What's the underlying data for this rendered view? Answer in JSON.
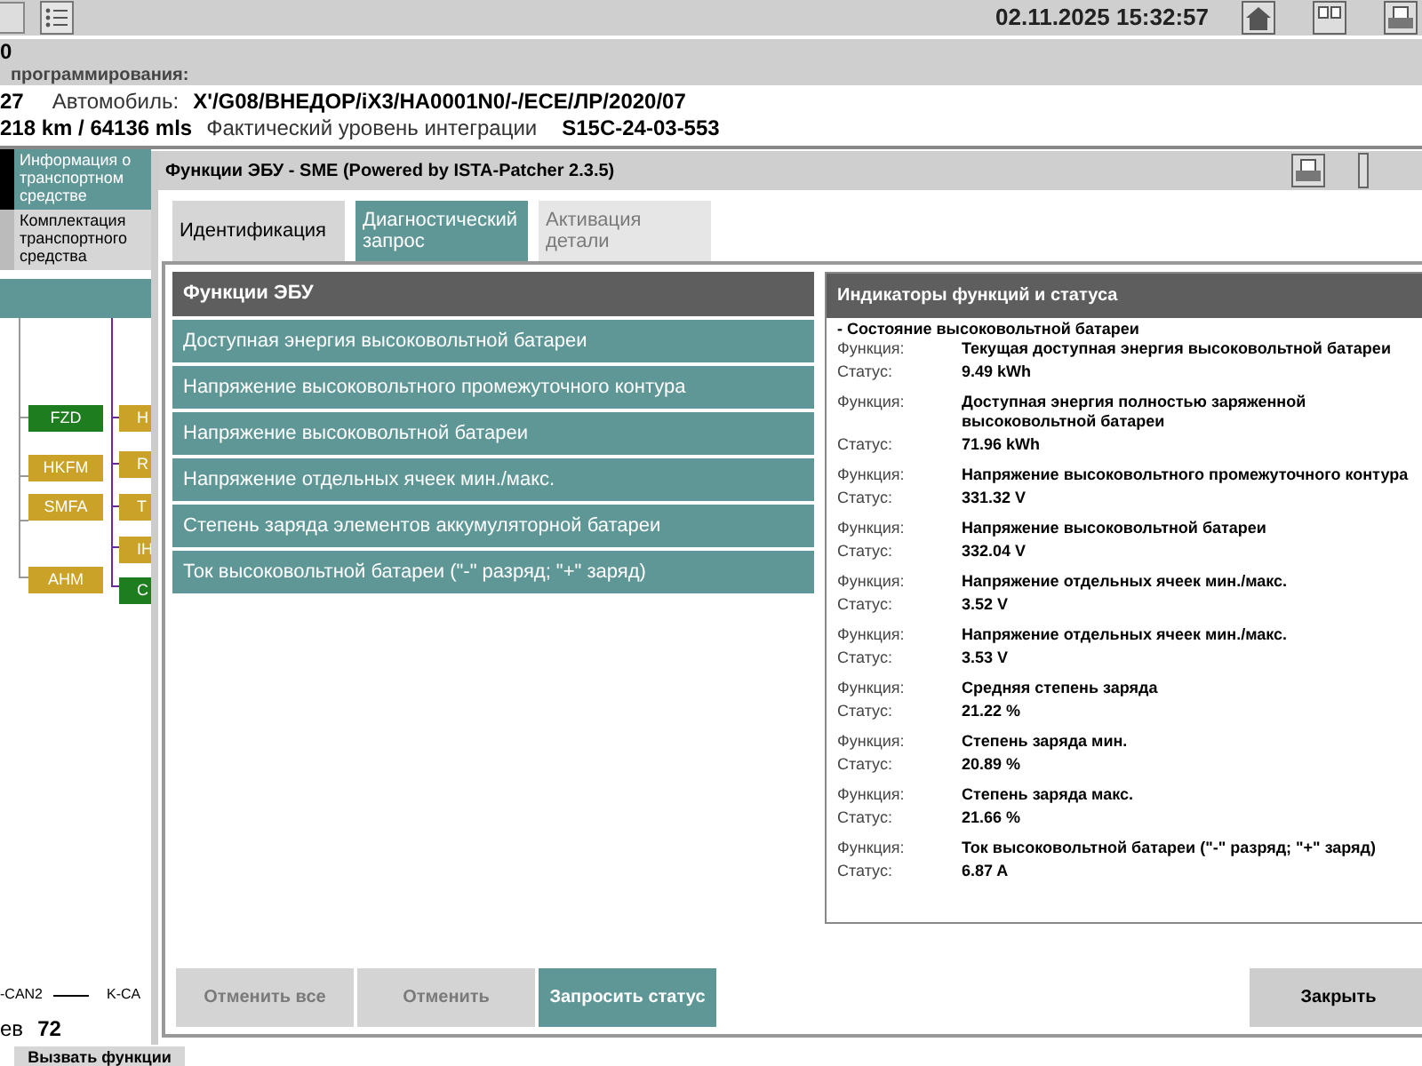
{
  "toolbar": {
    "datetime": "02.11.2025 15:32:57"
  },
  "header": {
    "line_1": "0",
    "line_2": "программирования:",
    "vehicle_prefix": "27",
    "vehicle_label": "Автомобиль:",
    "vehicle_value": "X'/G08/ВНЕДОР/iX3/HA0001N0/-/ECE/ЛР/2020/07",
    "mileage": "218 km / 64136 mls",
    "integration_label": "Фактический уровень интеграции",
    "integration_value": "S15C-24-03-553"
  },
  "side_tabs": [
    {
      "label": "Информация о транспортном средстве",
      "selected": true
    },
    {
      "label": "Комплектация транспортного средства",
      "selected": false
    }
  ],
  "diagram": {
    "nodes": [
      {
        "label": "FZD",
        "color": "#1e7d1e"
      },
      {
        "label": "HKFM",
        "color": "#c9a227"
      },
      {
        "label": "SMFA",
        "color": "#c9a227"
      },
      {
        "label": "AHM",
        "color": "#c9a227"
      }
    ],
    "cut_nodes": [
      {
        "label": "H",
        "color": "#c9a227"
      },
      {
        "label": "R",
        "color": "#c9a227"
      },
      {
        "label": "T",
        "color": "#c9a227"
      },
      {
        "label": "IH",
        "color": "#c9a227"
      },
      {
        "label": "C",
        "color": "#1e7d1e"
      }
    ],
    "bus_labels": [
      "-CAN2",
      "K-CA"
    ]
  },
  "footer": {
    "label": "ев",
    "value": "72",
    "button": "Вызвать функции"
  },
  "dialog": {
    "title": "Функции ЭБУ - SME (Powered by ISTA-Patcher 2.3.5)",
    "tabs": [
      {
        "label": "Идентификация",
        "selected": false,
        "disabled": false
      },
      {
        "label": "Диагностический запрос",
        "selected": true,
        "disabled": false
      },
      {
        "label": "Активация детали",
        "selected": false,
        "disabled": true
      }
    ],
    "functions": {
      "header": "Функции ЭБУ",
      "items": [
        "Доступная энергия высоковольтной батареи",
        "Напряжение высоковольтного промежуточного контура",
        "Напряжение высоковольтной батареи",
        "Напряжение отдельных ячеек мин./макс.",
        "Степень заряда элементов аккумуляторной батареи",
        "Ток высоковольтной батареи (\"-\" разряд; \"+\" заряд)"
      ]
    },
    "status": {
      "header": "Индикаторы функций и статуса",
      "group": "- Состояние высоковольтной батареи",
      "entries": [
        {
          "function_label": "Функция:",
          "function": "Текущая доступная энергия высоковольтной батареи",
          "status_label": "Статус:",
          "status": "9.49 kWh"
        },
        {
          "function_label": "Функция:",
          "function": "Доступная энергия полностью заряженной высоковольтной батареи",
          "status_label": "Статус:",
          "status": "71.96 kWh"
        },
        {
          "function_label": "Функция:",
          "function": "Напряжение высоковольтного промежуточного контура",
          "status_label": "Статус:",
          "status": "331.32 V"
        },
        {
          "function_label": "Функция:",
          "function": "Напряжение высоковольтной батареи",
          "status_label": "Статус:",
          "status": "332.04 V"
        },
        {
          "function_label": "Функция:",
          "function": "Напряжение отдельных ячеек мин./макс.",
          "status_label": "Статус:",
          "status": "3.52 V"
        },
        {
          "function_label": "Функция:",
          "function": "Напряжение отдельных ячеек мин./макс.",
          "status_label": "Статус:",
          "status": "3.53 V"
        },
        {
          "function_label": "Функция:",
          "function": "Средняя степень заряда",
          "status_label": "Статус:",
          "status": "21.22 %"
        },
        {
          "function_label": "Функция:",
          "function": "Степень заряда мин.",
          "status_label": "Статус:",
          "status": "20.89 %"
        },
        {
          "function_label": "Функция:",
          "function": "Степень заряда макс.",
          "status_label": "Статус:",
          "status": "21.66 %"
        },
        {
          "function_label": "Функция:",
          "function": "Ток высоковольтной батареи (\"-\" разряд; \"+\" заряд)",
          "status_label": "Статус:",
          "status": "6.87 A"
        }
      ]
    },
    "buttons": [
      {
        "label": "Отменить все",
        "kind": "secondary",
        "disabled": true
      },
      {
        "label": "Отменить",
        "kind": "secondary",
        "disabled": true
      },
      {
        "label": "Запросить статус",
        "kind": "primary",
        "disabled": false
      },
      {
        "label": "Закрыть",
        "kind": "close",
        "disabled": false
      }
    ]
  }
}
